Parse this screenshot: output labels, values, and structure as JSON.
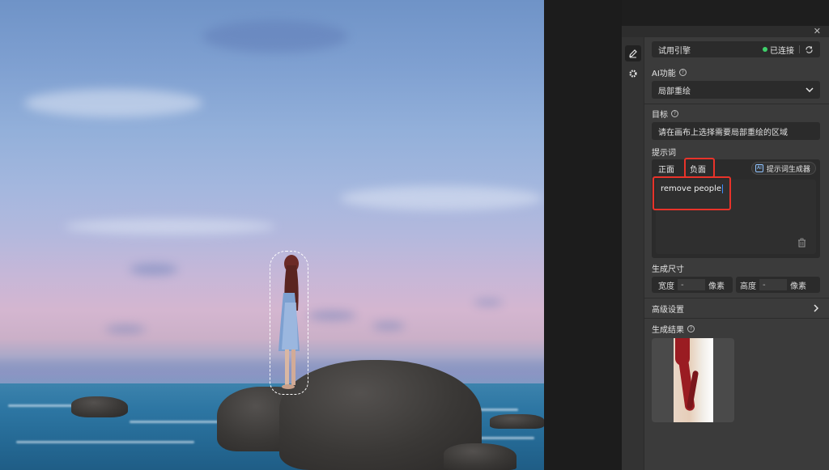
{
  "panel": {
    "close_icon": "close-icon",
    "toolbar": {
      "tool1_icon": "pen-icon",
      "tool2_icon": "gear-icon"
    },
    "engine": {
      "name": "试用引擎",
      "status": "已连接",
      "status_color": "#3fd16b",
      "action_icon": "refresh-icon"
    },
    "ai_function": {
      "label": "AI功能",
      "value": "局部重绘"
    },
    "target": {
      "label": "目标",
      "placeholder": "请在画布上选择需要局部重绘的区域"
    },
    "prompt": {
      "label": "提示词",
      "tabs": [
        "正面",
        "负面"
      ],
      "active_tab": "负面",
      "generator_badge": "AI",
      "generator_label": "提示词生成器",
      "text": "remove people"
    },
    "size": {
      "label": "生成尺寸",
      "width_label": "宽度",
      "width_value": "-",
      "height_label": "高度",
      "height_value": "-",
      "unit": "像素"
    },
    "advanced": {
      "label": "高级设置"
    },
    "result": {
      "label": "生成结果"
    }
  },
  "colors": {
    "highlight": "#e8332a",
    "panel_bg": "#3b3b3b",
    "field_bg": "#2b2b2b"
  }
}
